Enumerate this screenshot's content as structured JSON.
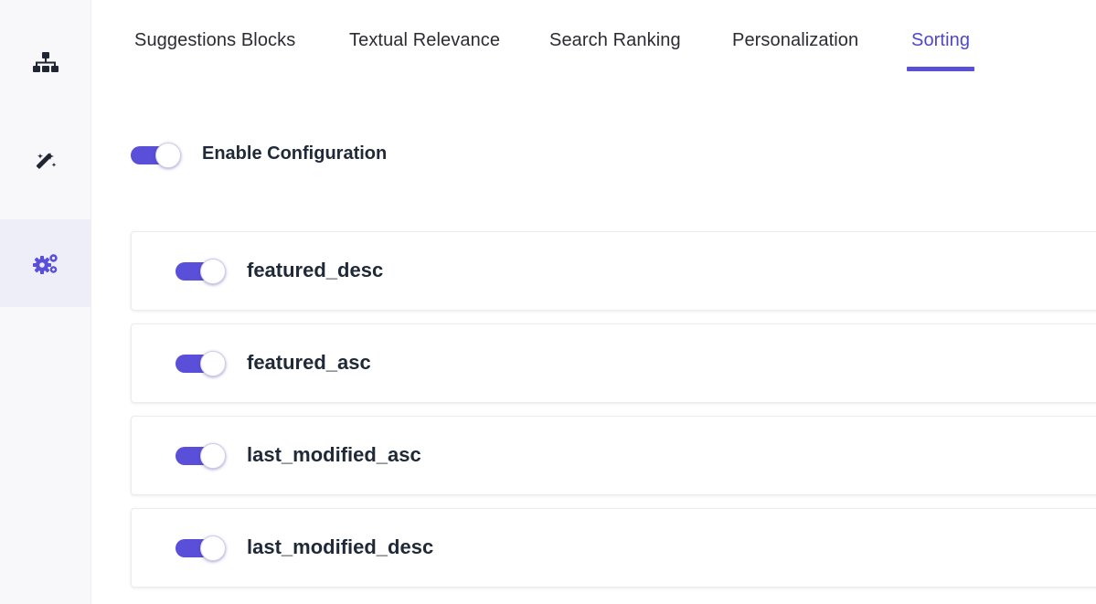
{
  "sidebar": {
    "items": [
      {
        "icon": "sitemap-icon",
        "active": false
      },
      {
        "icon": "magic-wand-icon",
        "active": false
      },
      {
        "icon": "gears-icon",
        "active": true
      }
    ]
  },
  "tabs": [
    {
      "label": "Suggestions Blocks",
      "active": false
    },
    {
      "label": "Textual Relevance",
      "active": false
    },
    {
      "label": "Search Ranking",
      "active": false
    },
    {
      "label": "Personalization",
      "active": false
    },
    {
      "label": "Sorting",
      "active": true
    }
  ],
  "enable_configuration": {
    "label": "Enable Configuration",
    "enabled": true
  },
  "sort_options": [
    {
      "label": "featured_desc",
      "enabled": true
    },
    {
      "label": "featured_asc",
      "enabled": true
    },
    {
      "label": "last_modified_asc",
      "enabled": true
    },
    {
      "label": "last_modified_desc",
      "enabled": true
    }
  ],
  "colors": {
    "accent": "#5a4fd9",
    "active_tab_text": "#4f46c8",
    "sidebar_bg": "#f8f8fa"
  }
}
